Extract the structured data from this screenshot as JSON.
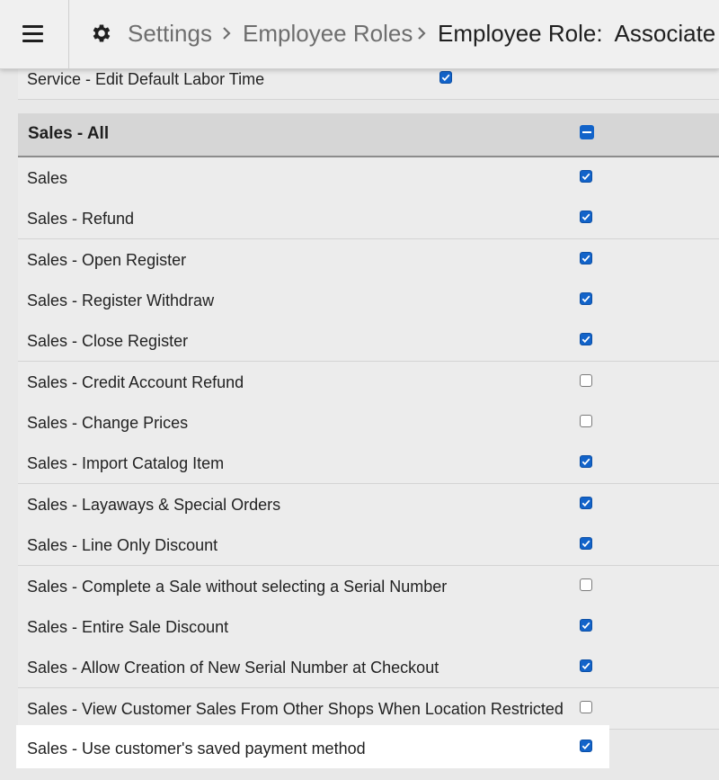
{
  "header": {
    "menu_icon": "hamburger-icon",
    "settings_icon": "gear-icon",
    "breadcrumbs": [
      "Settings",
      "Employee Roles",
      "Employee Role:  Associate"
    ]
  },
  "top_row": {
    "label": "Service - Edit Default Labor Time",
    "checked": true
  },
  "group": {
    "label": "Sales - All",
    "state": "partial"
  },
  "permissions": [
    {
      "label": "Sales",
      "checked": true
    },
    {
      "label": "Sales - Refund",
      "checked": true
    },
    {
      "label": "Sales - Open Register",
      "checked": true
    },
    {
      "label": "Sales - Register Withdraw",
      "checked": true
    },
    {
      "label": "Sales - Close Register",
      "checked": true
    },
    {
      "label": "Sales - Credit Account Refund",
      "checked": false
    },
    {
      "label": "Sales - Change Prices",
      "checked": false
    },
    {
      "label": "Sales - Import Catalog Item",
      "checked": true
    },
    {
      "label": "Sales - Layaways & Special Orders",
      "checked": true
    },
    {
      "label": "Sales - Line Only Discount",
      "checked": true
    },
    {
      "label": "Sales - Complete a Sale without selecting a Serial Number",
      "checked": false
    },
    {
      "label": "Sales - Entire Sale Discount",
      "checked": true
    },
    {
      "label": "Sales - Allow Creation of New Serial Number at Checkout",
      "checked": true
    },
    {
      "label": "Sales - View Customer Sales From Other Shops When Location Restricted",
      "checked": false
    }
  ],
  "highlighted_row": {
    "label": "Sales - Use customer's saved payment method",
    "checked": true
  },
  "colors": {
    "checkbox_checked": "#1263c9",
    "highlight_bg": "#ffffff",
    "page_bg": "#e8e8e8"
  }
}
